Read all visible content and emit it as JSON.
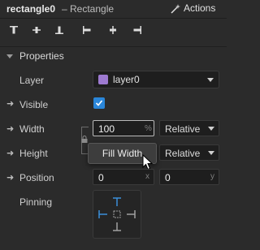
{
  "header": {
    "object_name": "rectangle0",
    "object_type": "– Rectangle",
    "actions_label": "Actions",
    "actions_icon": "magic-wand-icon"
  },
  "align_toolbar": {
    "buttons": [
      "align-top-icon",
      "align-vertical-center-icon",
      "align-bottom-icon",
      "align-left-icon",
      "align-horizontal-center-icon",
      "align-right-icon"
    ]
  },
  "properties": {
    "section_label": "Properties",
    "layer": {
      "label": "Layer",
      "value": "layer0",
      "swatch_color": "#9d7ad0"
    },
    "visible": {
      "label": "Visible",
      "checked": true
    },
    "width": {
      "label": "Width",
      "value": "100",
      "unit": "%",
      "mode": "Relative"
    },
    "height": {
      "label": "Height",
      "mode": "Relative"
    },
    "position": {
      "label": "Position",
      "x": "0",
      "y": "0",
      "x_unit": "x",
      "y_unit": "y"
    },
    "pinning": {
      "label": "Pinning"
    }
  },
  "context_menu": {
    "items": [
      "Fill Width"
    ]
  },
  "colors": {
    "background": "#2b2b2b",
    "accent": "#2a86d9",
    "pin_active": "#3b8fd9"
  }
}
